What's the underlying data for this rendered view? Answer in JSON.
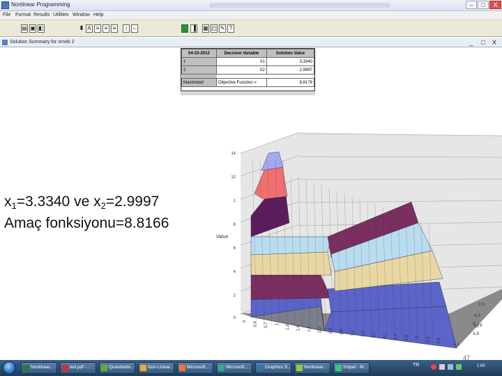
{
  "window": {
    "title": "Nonlinear Programming",
    "buttons": {
      "minimize": "–",
      "maximize": "□",
      "close": "X"
    }
  },
  "menu": [
    "File",
    "Format",
    "Results",
    "Utilities",
    "Window",
    "Help"
  ],
  "child_window": {
    "title": "Solution Summary for ornek 2",
    "buttons": {
      "minimize": "_",
      "maximize": "□",
      "close": "X"
    }
  },
  "summary_table": {
    "headers": [
      "04-23-2012",
      "Decision Variable",
      "Solution Value"
    ],
    "rows": [
      {
        "index": "1",
        "variable": "X1",
        "value": "3,3340"
      },
      {
        "index": "2",
        "variable": "X2",
        "value": "2,9997"
      }
    ],
    "footer": {
      "label": "Maximized",
      "variable": "Objective Function =",
      "value": "8,8176"
    }
  },
  "slide": {
    "line1": {
      "a": "x",
      "sub1": "1",
      "b": "=3.3340 ve x",
      "sub2": "2",
      "c": "=2.9997"
    },
    "line2": "Amaç fonksiyonu=8.8166",
    "page_number": "47"
  },
  "chart_data": {
    "type": "surface",
    "title": "",
    "zlabel": "Value",
    "z_ticks": [
      "0",
      "1",
      "2",
      "4",
      "6",
      "8",
      "1",
      "12",
      "14"
    ],
    "x_ticks": [
      "0",
      "0,4",
      "0,7",
      "1",
      "1,3",
      "1,6",
      "1,9",
      "2,2",
      "2,5",
      "2,8",
      "3,1",
      "3,4",
      "3,7",
      "4,1",
      "4,4",
      "4,8",
      "5",
      "5,3",
      "5,6"
    ],
    "y_ticks": [
      "2,9",
      "4,3",
      "5",
      "6",
      "3,8",
      "1,1"
    ],
    "y_axis_label": "x2",
    "bands": [
      "#7b7f8c",
      "#5b64c8",
      "#7a2f60",
      "#e9d7a3",
      "#b9dcef",
      "#5b1d5e",
      "#f07070",
      "#a4a8f0"
    ],
    "peak": {
      "value": 14,
      "location": "left-rear"
    }
  },
  "taskbar": {
    "tasks": [
      "Nonlinear...",
      "ted.pdf -...",
      "Quantitativ...",
      "Non-Linear...",
      "Microsoft...",
      "Microsoft...",
      "Graphics S...",
      "Nonlinear...",
      "Snipet - M..."
    ],
    "language": "TR",
    "clock": "1:00"
  }
}
